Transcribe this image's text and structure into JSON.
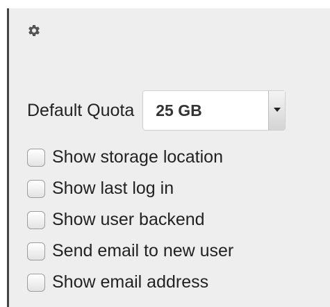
{
  "settings": {
    "icon": "gear-icon",
    "default_quota": {
      "label": "Default Quota",
      "value": "25 GB"
    },
    "options": [
      {
        "label": "Show storage location",
        "checked": false
      },
      {
        "label": "Show last log in",
        "checked": false
      },
      {
        "label": "Show user backend",
        "checked": false
      },
      {
        "label": "Send email to new user",
        "checked": false
      },
      {
        "label": "Show email address",
        "checked": false
      }
    ]
  }
}
